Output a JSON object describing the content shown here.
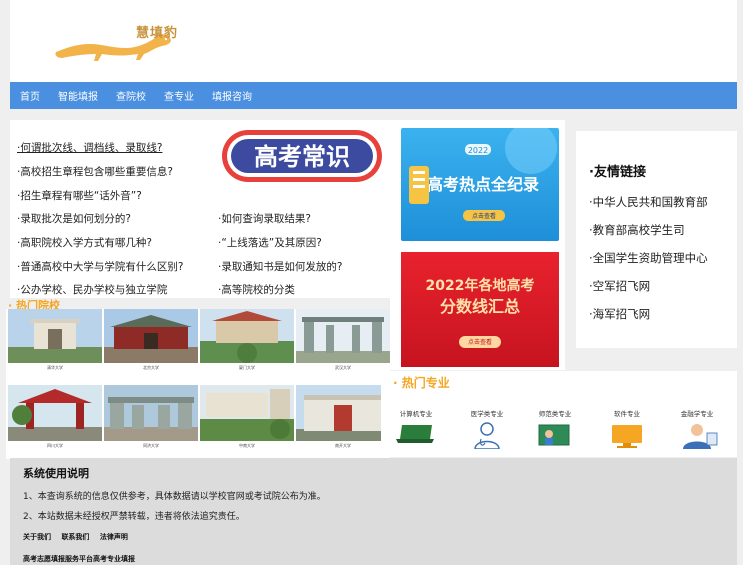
{
  "logo": {
    "text": "慧填豹"
  },
  "nav": {
    "items": [
      {
        "label": "首页"
      },
      {
        "label": "智能填报"
      },
      {
        "label": "查院校"
      },
      {
        "label": "查专业"
      },
      {
        "label": "填报咨询"
      }
    ]
  },
  "faq": {
    "banner_text": "高考常识",
    "left": [
      "·何谓批次线、调档线、录取线?",
      "·高校招生章程包含哪些重要信息?",
      "·招生章程有哪些“话外音”?",
      "·录取批次是如何划分的?",
      "·高职院校入学方式有哪几种?",
      "·普通高校中大学与学院有什么区别?",
      "·公办学校、民办学校与独立学院"
    ],
    "right": [
      "·如何查询录取结果?",
      "·“上线落选”及其原因?",
      "·录取通知书是如何发放的?",
      "·高等院校的分类"
    ]
  },
  "promos": {
    "a": {
      "year": "2022",
      "title": "高考热点全纪录",
      "button": "点击查看"
    },
    "b": {
      "title_line1": "2022年各地高考",
      "title_line2": "分数线汇总",
      "button": "点击查看"
    }
  },
  "friends": {
    "title": "·友情链接",
    "links": [
      "·中华人民共和国教育部",
      "·教育部高校学生司",
      "·全国学生资助管理中心",
      "·空军招飞网",
      "·海军招飞网"
    ]
  },
  "hot_colleges": {
    "title": "· 热门院校",
    "items": [
      {
        "name": "清华大学"
      },
      {
        "name": "北京大学"
      },
      {
        "name": "厦门大学"
      },
      {
        "name": "武汉大学"
      },
      {
        "name": "四川大学"
      },
      {
        "name": "同济大学"
      },
      {
        "name": "中南大学"
      },
      {
        "name": "南开大学"
      }
    ]
  },
  "hot_majors": {
    "title": "· 热门专业",
    "items": [
      {
        "label": "计算机专业"
      },
      {
        "label": "医学类专业"
      },
      {
        "label": "师范类专业"
      },
      {
        "label": "软件专业"
      },
      {
        "label": "金融学专业"
      }
    ]
  },
  "footer": {
    "title": "系统使用说明",
    "line1": "1、本查询系统的信息仅供参考，具体数据请以学校官网或考试院公布为准。",
    "line2": "2、本站数据未经授权严禁转载，违者将依法追究责任。",
    "links": [
      "关于我们",
      "联系我们",
      "法律声明"
    ],
    "platform": "高考志愿填报服务平台高考专业填报"
  },
  "colors": {
    "nav_bg": "#4a8fe0",
    "accent_orange": "#f5a623",
    "footer_bg": "#dcdcdc"
  }
}
